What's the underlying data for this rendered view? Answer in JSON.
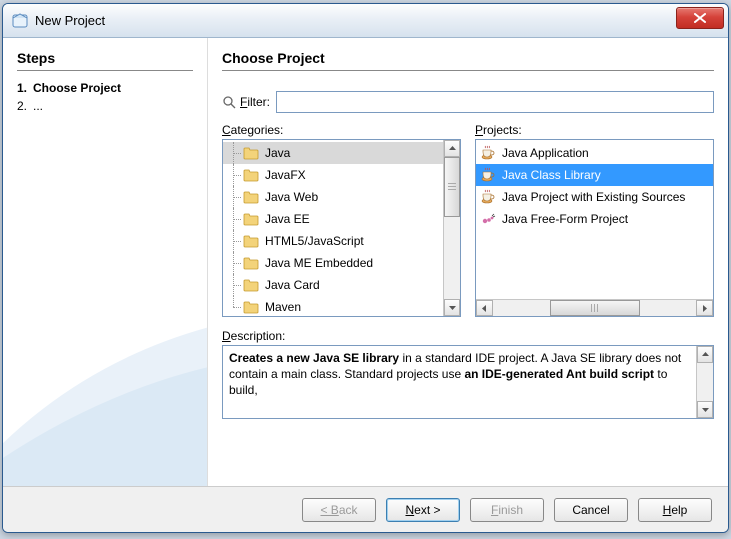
{
  "window": {
    "title": "New Project"
  },
  "steps": {
    "heading": "Steps",
    "items": [
      {
        "num": "1.",
        "label": "Choose Project"
      },
      {
        "num": "2.",
        "label": "..."
      }
    ]
  },
  "main": {
    "heading": "Choose Project",
    "filter_label": "Filter:",
    "filter_value": "",
    "categories_label": "Categories:",
    "projects_label": "Projects:",
    "description_label": "Description:",
    "description_html": "<b>Creates a new Java SE library</b> in a standard IDE project. A Java SE library does not contain a main class. Standard projects use <b>an IDE-generated Ant build script</b> to build,"
  },
  "categories": [
    {
      "label": "Java",
      "selected": true
    },
    {
      "label": "JavaFX"
    },
    {
      "label": "Java Web"
    },
    {
      "label": "Java EE"
    },
    {
      "label": "HTML5/JavaScript"
    },
    {
      "label": "Java ME Embedded"
    },
    {
      "label": "Java Card"
    },
    {
      "label": "Maven"
    }
  ],
  "projects": [
    {
      "label": "Java Application",
      "icon": "cup"
    },
    {
      "label": "Java Class Library",
      "icon": "cup",
      "selected": true
    },
    {
      "label": "Java Project with Existing Sources",
      "icon": "cup"
    },
    {
      "label": "Java Free-Form Project",
      "icon": "ant"
    }
  ],
  "buttons": {
    "back": "< Back",
    "next": "Next >",
    "finish": "Finish",
    "cancel": "Cancel",
    "help": "Help"
  }
}
